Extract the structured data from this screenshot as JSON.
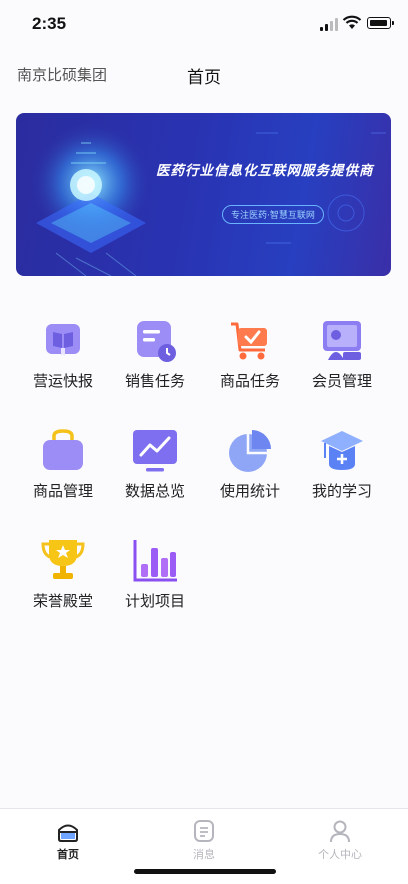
{
  "status_bar": {
    "time": "2:35",
    "signal_icon": "signal-icon",
    "wifi_icon": "wifi-icon",
    "battery_icon": "battery-icon"
  },
  "header": {
    "company": "南京比硕集团",
    "title": "首页"
  },
  "banner": {
    "title": "医药行业信息化互联网服务提供商",
    "subtitle": "专注医药·智慧互联网"
  },
  "grid": [
    {
      "label": "营运快报",
      "icon": "book-icon"
    },
    {
      "label": "销售任务",
      "icon": "task-list-icon"
    },
    {
      "label": "商品任务",
      "icon": "cart-icon"
    },
    {
      "label": "会员管理",
      "icon": "teacher-board-icon"
    },
    {
      "label": "商品管理",
      "icon": "bag-icon"
    },
    {
      "label": "数据总览",
      "icon": "line-chart-monitor-icon"
    },
    {
      "label": "使用统计",
      "icon": "pie-chart-icon"
    },
    {
      "label": "我的学习",
      "icon": "graduation-cap-icon"
    },
    {
      "label": "荣誉殿堂",
      "icon": "trophy-icon"
    },
    {
      "label": "计划项目",
      "icon": "bar-chart-icon"
    }
  ],
  "tabbar": [
    {
      "label": "首页",
      "active": true,
      "icon": "home-icon"
    },
    {
      "label": "消息",
      "active": false,
      "icon": "message-icon"
    },
    {
      "label": "个人中心",
      "active": false,
      "icon": "person-icon"
    }
  ],
  "colors": {
    "purple": "#8a7cf0",
    "orange": "#ff6a3d",
    "gold": "#f5c21b",
    "tab_active": "#222222",
    "tab_inactive": "#b5b5bd"
  }
}
